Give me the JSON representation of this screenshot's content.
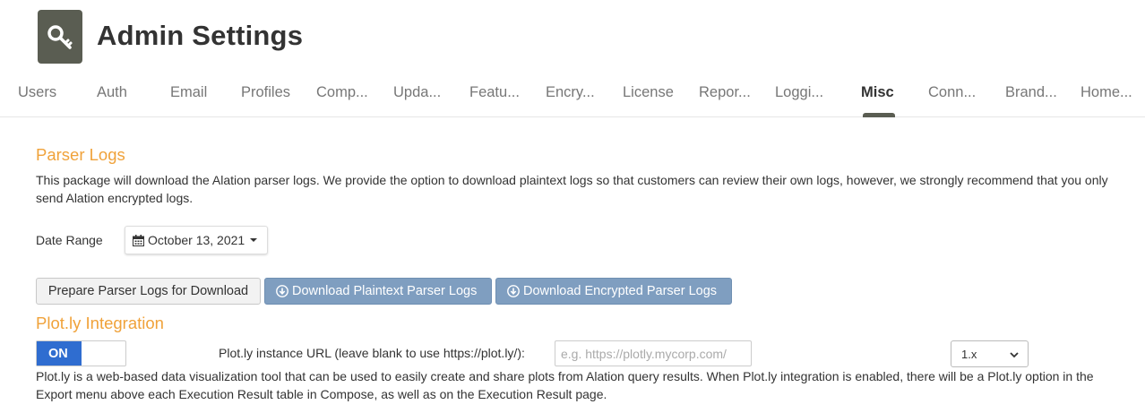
{
  "header": {
    "title": "Admin Settings",
    "icon": "key-icon"
  },
  "tabs": [
    {
      "label": "Users"
    },
    {
      "label": "Auth"
    },
    {
      "label": "Email"
    },
    {
      "label": "Profiles"
    },
    {
      "label": "Comp..."
    },
    {
      "label": "Upda..."
    },
    {
      "label": "Featu..."
    },
    {
      "label": "Encry..."
    },
    {
      "label": "License"
    },
    {
      "label": "Repor..."
    },
    {
      "label": "Loggi..."
    },
    {
      "label": "Misc",
      "active": true
    },
    {
      "label": "Conn..."
    },
    {
      "label": "Brand..."
    },
    {
      "label": "Home..."
    }
  ],
  "parser_logs": {
    "title": "Parser Logs",
    "description": "This package will download the Alation parser logs. We provide the option to download plaintext logs so that customers can review their own logs, however, we strongly recommend that you only send Alation encrypted logs.",
    "date_range_label": "Date Range",
    "date_value": "October 13, 2021",
    "prepare_button": "Prepare Parser Logs for Download",
    "download_plaintext_button": "Download Plaintext Parser Logs",
    "download_encrypted_button": "Download Encrypted Parser Logs"
  },
  "plotly": {
    "title": "Plot.ly Integration",
    "toggle_label": "ON",
    "url_label": "Plot.ly instance URL (leave blank to use https://plot.ly/):",
    "url_placeholder": "e.g. https://plotly.mycorp.com/",
    "version_selected": "1.x",
    "description": "Plot.ly is a web-based data visualization tool that can be used to easily create and share plots from Alation query results. When Plot.ly integration is enabled, there will be a Plot.ly option in the Export menu above each Execution Result table in Compose, as well as on the Execution Result page."
  },
  "colors": {
    "section_title": "#f0a23a",
    "primary_button": "#7f9ec0",
    "toggle_on": "#2f6dd0",
    "app_icon_bg": "#5a5d52"
  }
}
